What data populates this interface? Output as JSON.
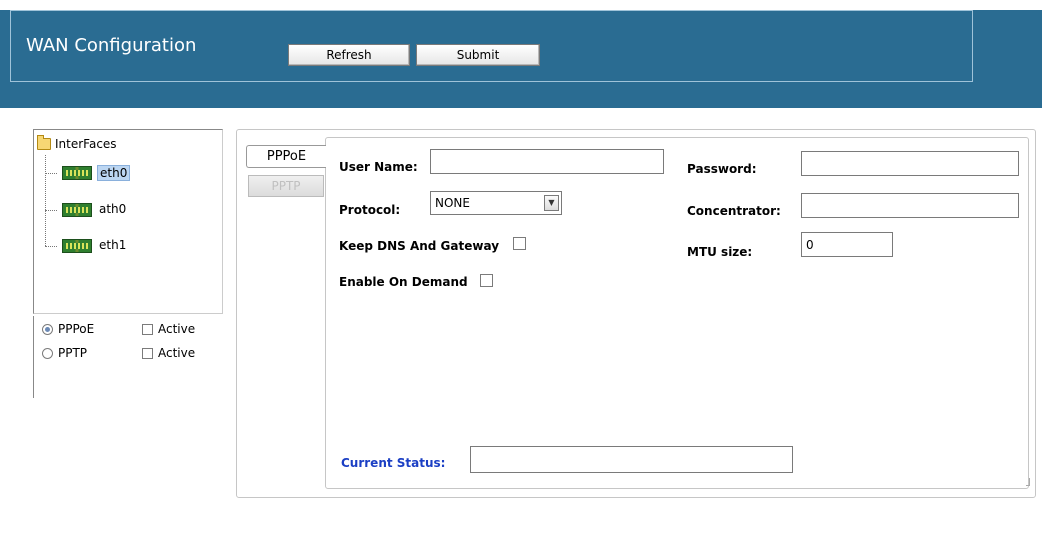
{
  "header": {
    "title": "WAN Configuration",
    "refresh_label": "Refresh",
    "submit_label": "Submit"
  },
  "tree": {
    "root_label": "InterFaces",
    "items": [
      {
        "label": "eth0",
        "selected": true
      },
      {
        "label": "ath0",
        "selected": false
      },
      {
        "label": "eth1",
        "selected": false
      }
    ]
  },
  "options": [
    {
      "label": "PPPoE",
      "selected": true,
      "active_label": "Active",
      "active_checked": false
    },
    {
      "label": "PPTP",
      "selected": false,
      "active_label": "Active",
      "active_checked": false
    }
  ],
  "tabs": [
    {
      "label": "PPPoE",
      "active": true
    },
    {
      "label": "PPTP",
      "active": false
    }
  ],
  "form": {
    "user_name_label": "User Name:",
    "user_name_value": "",
    "password_label": "Password:",
    "password_value": "",
    "protocol_label": "Protocol:",
    "protocol_value": "NONE",
    "concentrator_label": "Concentrator:",
    "concentrator_value": "",
    "keep_dns_label": "Keep DNS And Gateway",
    "keep_dns_checked": false,
    "mtu_label": "MTU size:",
    "mtu_value": "0",
    "enable_on_demand_label": "Enable On Demand",
    "enable_on_demand_checked": false,
    "current_status_label": "Current Status:",
    "current_status_value": ""
  },
  "colors": {
    "header_bg": "#2a6c92",
    "status_label": "#1b3fc4",
    "selection_bg": "#bcd6f2"
  },
  "icons": [
    "folder-icon",
    "network-card-icon",
    "dropdown-arrow-icon"
  ]
}
